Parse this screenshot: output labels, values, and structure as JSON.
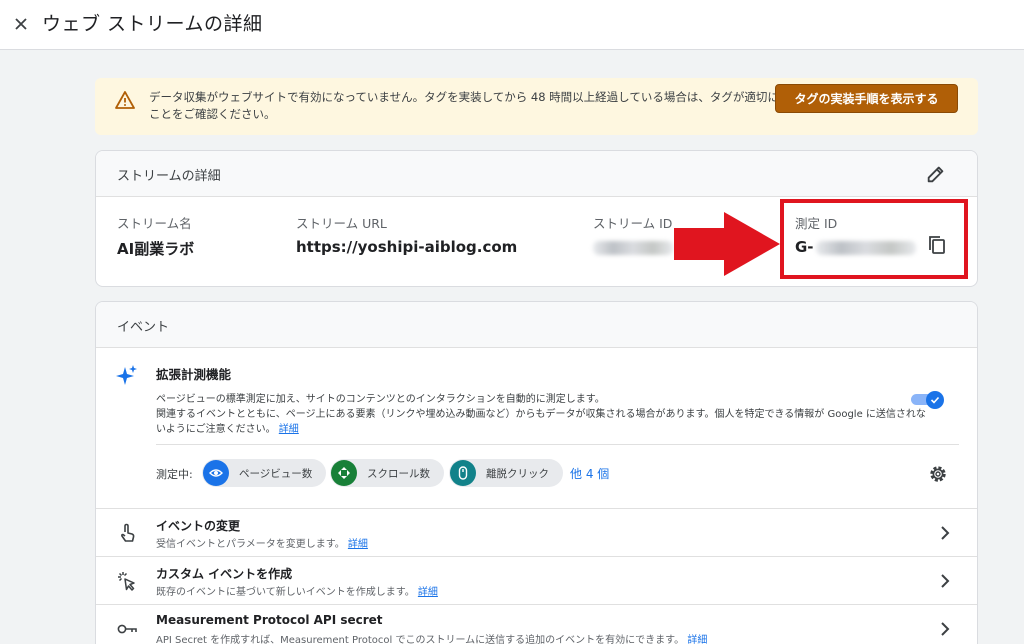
{
  "page": {
    "title": "ウェブ ストリームの詳細"
  },
  "banner": {
    "message": "データ収集がウェブサイトで有効になっていません。タグを実装してから 48 時間以上経過している場合は、タグが適切に設定されていることをご確認ください。",
    "button_label": "タグの実装手順を表示する"
  },
  "stream_details": {
    "header": "ストリームの詳細",
    "fields": {
      "stream_name_label": "ストリーム名",
      "stream_name": "AI副業ラボ",
      "stream_url_label": "ストリーム URL",
      "stream_url": "https://yoshipi-aiblog.com",
      "stream_id_label": "ストリーム ID",
      "measurement_id_label": "測定 ID",
      "measurement_id_prefix": "G-"
    }
  },
  "events": {
    "header": "イベント",
    "enhanced": {
      "title": "拡張計測機能",
      "desc_line1": "ページビューの標準測定に加え、サイトのコンテンツとのインタラクションを自動的に測定します。",
      "desc_line2": "関連するイベントとともに、ページ上にある要素（リンクや埋め込み動画など）からもデータが収集される場合があります。個人を特定できる情報が Google に送信されないようにご注意ください。",
      "details_link": "詳細",
      "measuring_label": "測定中:",
      "chips": [
        "ページビュー数",
        "スクロール数",
        "離脱クリック"
      ],
      "more": "他 4 個"
    },
    "rows": [
      {
        "title": "イベントの変更",
        "subtitle": "受信イベントとパラメータを変更します。",
        "link": "詳細"
      },
      {
        "title": "カスタム イベントを作成",
        "subtitle": "既存のイベントに基づいて新しいイベントを作成します。",
        "link": "詳細"
      },
      {
        "title": "Measurement Protocol API secret",
        "subtitle": "API Secret を作成すれば、Measurement Protocol でこのストリームに送信する追加のイベントを有効にできます。",
        "link": "詳細"
      }
    ]
  },
  "colors": {
    "accent": "#1a73e8",
    "banner_bg": "#fef7e0",
    "banner_button": "#b05f07",
    "highlight": "#e0151f",
    "chip_pageview": "#1a73e8",
    "chip_scroll": "#188038",
    "chip_outbound": "#12828a"
  },
  "icons": {
    "close": "close-icon",
    "warning": "warning-icon",
    "edit": "pencil-icon",
    "copy": "copy-icon",
    "sparkle": "sparkle-icon",
    "gear": "gear-icon",
    "touch": "touch-icon",
    "click": "click-icon",
    "key": "key-icon",
    "chevron": "chevron-right-icon"
  }
}
